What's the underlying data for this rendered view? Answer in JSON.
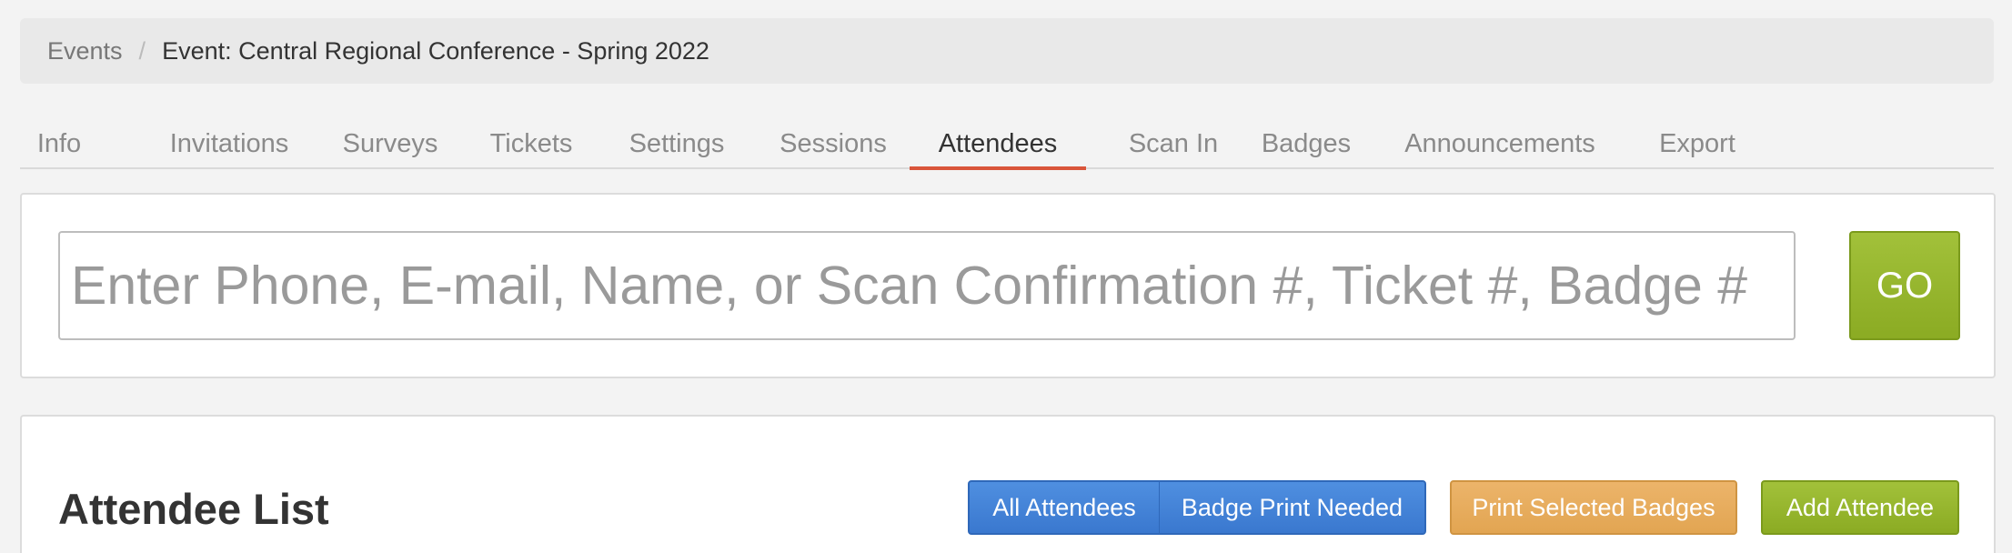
{
  "breadcrumb": {
    "parent": "Events",
    "separator": "/",
    "current": "Event: Central Regional Conference - Spring 2022"
  },
  "tabs": [
    {
      "label": "Info"
    },
    {
      "label": "Invitations"
    },
    {
      "label": "Surveys"
    },
    {
      "label": "Tickets"
    },
    {
      "label": "Settings"
    },
    {
      "label": "Sessions"
    },
    {
      "label": "Attendees",
      "active": true
    },
    {
      "label": "Scan In"
    },
    {
      "label": "Badges"
    },
    {
      "label": "Announcements"
    },
    {
      "label": "Export"
    }
  ],
  "search": {
    "value": "",
    "placeholder": "Enter Phone, E-mail, Name, or Scan Confirmation #, Ticket #, Badge #",
    "go_label": "GO"
  },
  "attendee_list": {
    "title": "Attendee List",
    "filter_all_label": "All Attendees",
    "filter_badge_needed_label": "Badge Print Needed",
    "print_label": "Print Selected Badges",
    "add_label": "Add Attendee"
  },
  "colors": {
    "active_tab_underline": "#d9553a",
    "primary_blue": "#3a78cf",
    "go_green": "#8bab23",
    "print_orange": "#e2a552"
  }
}
